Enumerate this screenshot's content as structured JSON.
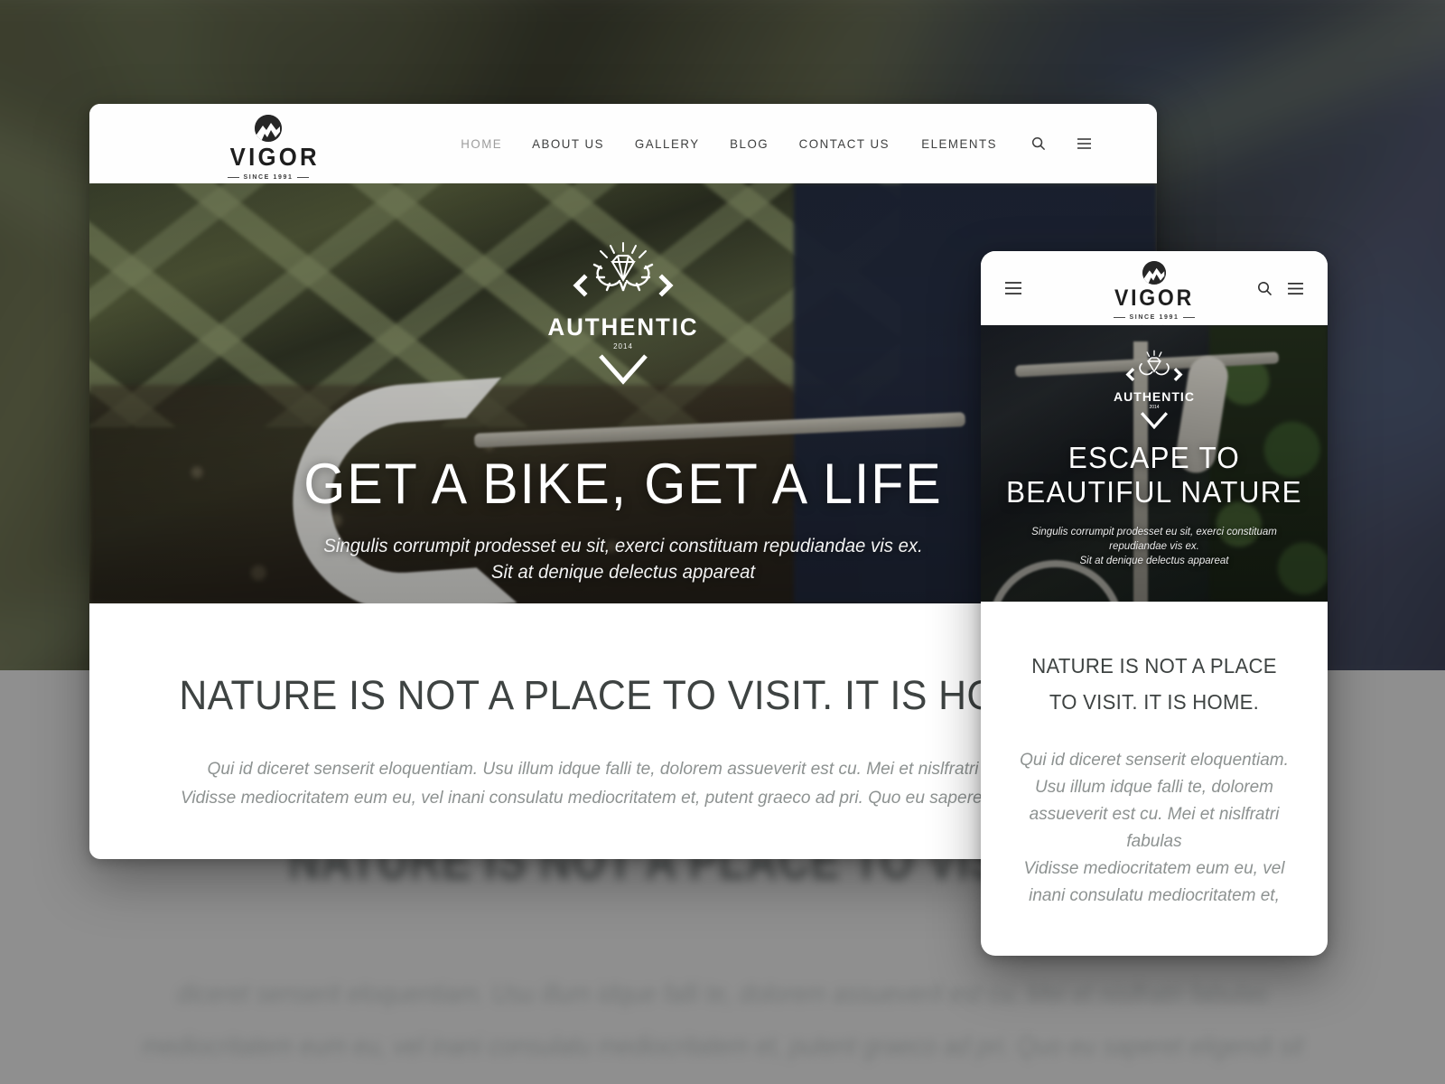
{
  "brand": {
    "name": "VIGOR",
    "tagline": "SINCE 1991",
    "dots": "• • •",
    "mark_icon": "mountain-circle-icon"
  },
  "desktop": {
    "nav": {
      "items": [
        {
          "label": "HOME",
          "active": true
        },
        {
          "label": "ABOUT US",
          "active": false
        },
        {
          "label": "GALLERY",
          "active": false
        },
        {
          "label": "BLOG",
          "active": false
        },
        {
          "label": "CONTACT US",
          "active": false
        },
        {
          "label": "ELEMENTS",
          "active": false
        }
      ],
      "search_icon": "search-icon",
      "menu_icon": "hamburger-menu-icon"
    },
    "hero": {
      "badge": {
        "word": "AUTHENTIC",
        "year": "2014",
        "emblem_icon": "diamond-antlers-emblem-icon"
      },
      "heading": "GET A BIKE, GET A LIFE",
      "subtitle_line1": "Singulis corrumpit prodesset eu sit, exerci constituam repudiandae vis ex.",
      "subtitle_line2": "Sit at denique delectus appareat"
    },
    "section": {
      "title": "NATURE IS NOT A PLACE TO VISIT. IT IS HOME.",
      "paragraph_line1": "Qui id diceret senserit eloquentiam. Usu illum idque falli te, dolorem assueverit est cu. Mei et nislfratri fabulas",
      "paragraph_line2": "Vidisse mediocritatem eum eu, vel inani consulatu mediocritatem et, putent graeco ad pri. Quo eu saperet eligendi sit"
    }
  },
  "mobile": {
    "header": {
      "menu_left_icon": "hamburger-menu-icon",
      "search_icon": "search-icon",
      "menu_right_icon": "hamburger-menu-icon"
    },
    "hero": {
      "badge": {
        "word": "AUTHENTIC",
        "year": "2014",
        "emblem_icon": "diamond-antlers-emblem-icon"
      },
      "heading": "ESCAPE TO BEAUTIFUL NATURE",
      "subtitle_line1": "Singulis corrumpit prodesset eu sit, exerci constituam",
      "subtitle_line2": "repudiandae vis ex.",
      "subtitle_line3": "Sit at denique delectus appareat"
    },
    "section": {
      "title": "NATURE IS NOT A PLACE TO VISIT. IT IS HOME.",
      "paragraph_lines": [
        "Qui id diceret senserit eloquentiam.",
        "Usu illum idque falli te, dolorem",
        "assueverit est cu. Mei et nislfratri",
        "fabulas",
        "Vidisse mediocritatem eum eu, vel",
        "inani consulatu mediocritatem et,"
      ]
    }
  },
  "background": {
    "blurred_title": "NATURE IS NOT A PLACE TO VISIT. IT IS",
    "blurred_line1": "diceret senserit eloquentiam. Usu illum idque falli te, dolorem assueverit est cu. Mei et nislfratri fabulas",
    "blurred_line2": "mediocritatem eum eu, vel inani consulatu mediocritatem et, putent graeco ad pri. Quo eu saperet eligendi sit"
  },
  "colors": {
    "page_backdrop": "#8f8f8f",
    "card_surface": "#ffffff",
    "heading_text": "#3e4342",
    "body_text": "#8d9291",
    "nav_text": "#3f4040",
    "nav_active": "#9d9d9d",
    "logo_dark": "#1e1e1e",
    "hero_text": "#ffffff"
  }
}
